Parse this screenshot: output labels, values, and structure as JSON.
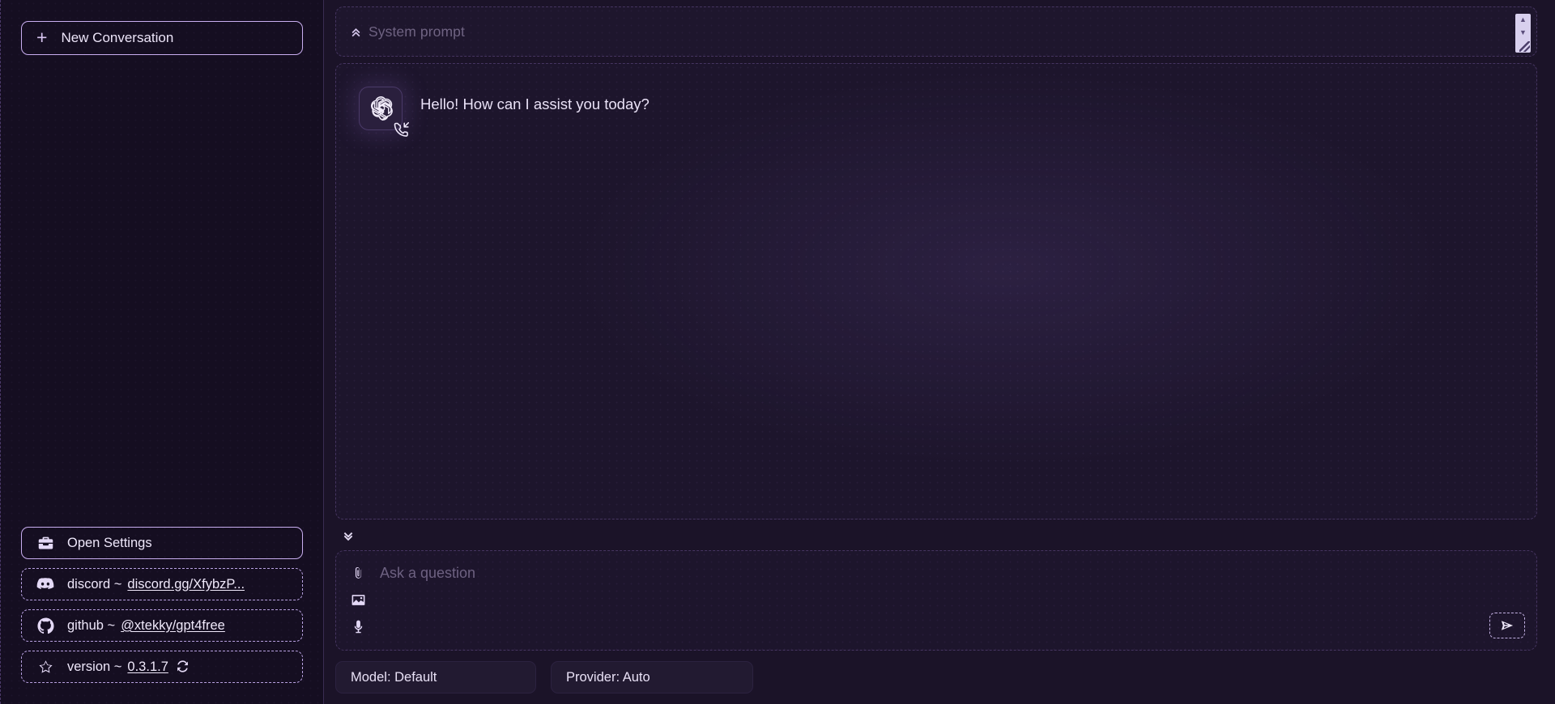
{
  "theme": {
    "page_bg": "#1b1328",
    "sidebar_bg": "#150e21",
    "panel_bg": "#1d152c",
    "accent": "#c9aef0",
    "text": "#e9e1f6",
    "muted_text": "#6f6382"
  },
  "sidebar": {
    "new_conversation": {
      "label": "New Conversation",
      "icon": "plus-icon",
      "plus_glyph": "+"
    },
    "footer_items": [
      {
        "name": "open-settings",
        "icon": "toolbox-icon",
        "label": "Open Settings",
        "style": "solid"
      },
      {
        "name": "discord-link",
        "icon": "discord-icon",
        "prefix": "discord ~",
        "link_text": "discord.gg/XfybzP...",
        "style": "dashed"
      },
      {
        "name": "github-link",
        "icon": "github-icon",
        "prefix": "github ~",
        "link_text": "@xtekky/gpt4free",
        "style": "dashed"
      },
      {
        "name": "version-info",
        "icon": "star-icon",
        "prefix": "version ~",
        "link_text": "0.3.1.7",
        "trailing_icon": "refresh-icon",
        "style": "dashed"
      }
    ]
  },
  "system_prompt": {
    "placeholder": "System prompt",
    "value": "",
    "toggle_icon": "chevrons-up-icon",
    "scrollbar": {
      "up_glyph": "▲",
      "down_glyph": "▼",
      "resize_icon": "resize-grip-icon"
    }
  },
  "chat": {
    "messages": [
      {
        "role": "assistant",
        "avatar_icon": "openai-logo-icon",
        "badge_icon": "phone-incoming-icon",
        "text": "Hello! How can I assist you today?"
      }
    ],
    "scroll_bottom_icon": "chevrons-down-icon"
  },
  "composer": {
    "placeholder": "Ask a question",
    "value": "",
    "icons": [
      {
        "name": "attach-file-icon",
        "title": "paperclip"
      },
      {
        "name": "image-upload-icon",
        "title": "image"
      },
      {
        "name": "microphone-icon",
        "title": "microphone"
      }
    ],
    "send_button": {
      "icon": "send-icon",
      "label": ""
    }
  },
  "bottom_bar": {
    "model_select": {
      "label": "Model: Default",
      "selected": "Default"
    },
    "provider_select": {
      "label": "Provider: Auto",
      "selected": "Auto"
    }
  }
}
